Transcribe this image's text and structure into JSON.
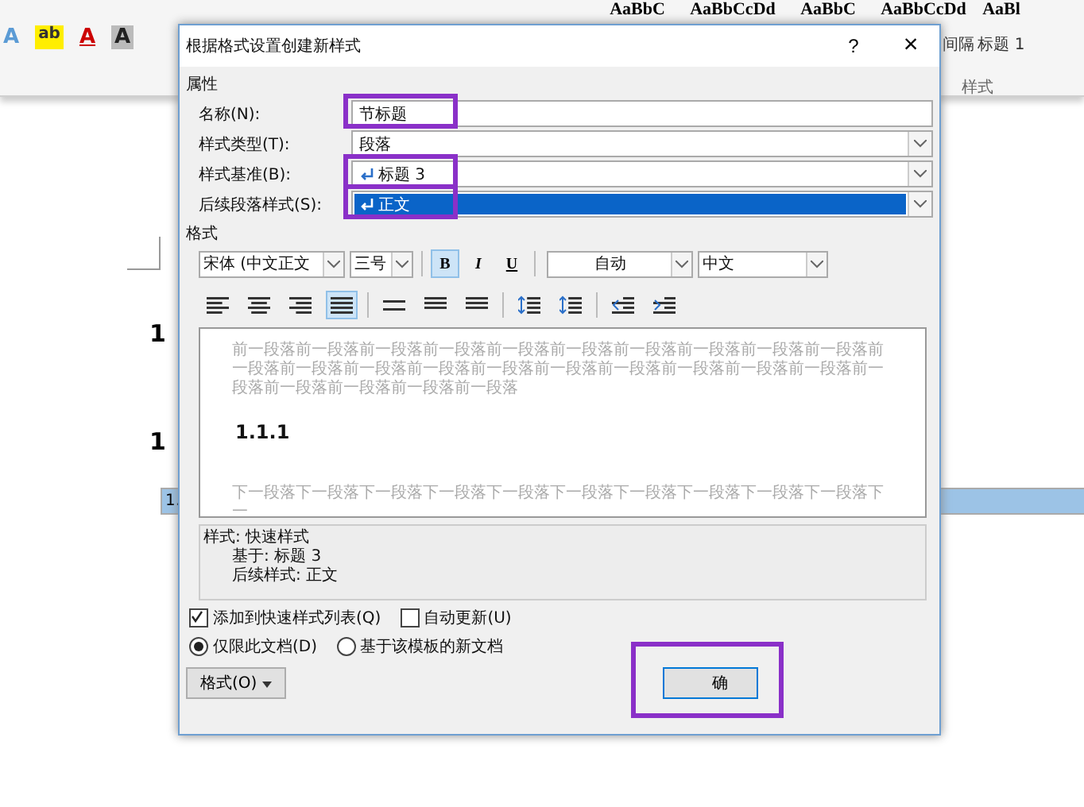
{
  "ribbon": {
    "tools": [
      "A",
      "ab",
      "A",
      "A"
    ],
    "styles": [
      {
        "preview": "AaBbC"
      },
      {
        "preview": "AaBbCcDd"
      },
      {
        "preview": "AaBbC"
      },
      {
        "preview": "AaBbCcDd",
        "label": "间隔"
      },
      {
        "preview": "AaBl",
        "label": "标题 1"
      }
    ],
    "group_label": "样式"
  },
  "document": {
    "lines": [
      {
        "text": "1",
        "selected": false
      },
      {
        "text": "1",
        "selected": false
      },
      {
        "text": "1.",
        "selected": true
      }
    ]
  },
  "dialog": {
    "title": "根据格式设置创建新样式",
    "help": "?",
    "close": "×",
    "properties_label": "属性",
    "fields": [
      {
        "label": "名称(N):",
        "value": "节标题",
        "kind": "text",
        "highlighted": true,
        "selected": false
      },
      {
        "label": "样式类型(T):",
        "value": "段落",
        "kind": "select",
        "highlighted": false,
        "selected": false
      },
      {
        "label": "样式基准(B):",
        "value": "标题 3",
        "kind": "select-style",
        "highlighted": true,
        "selected": false
      },
      {
        "label": "后续段落样式(S):",
        "value": "正文",
        "kind": "select-style",
        "highlighted": true,
        "selected": true
      }
    ],
    "format_label": "格式",
    "font": "宋体 (中文正文",
    "size": "三号",
    "styles": [
      {
        "label": "B",
        "selected": true
      },
      {
        "label": "I",
        "selected": false
      },
      {
        "label": "U",
        "selected": false
      }
    ],
    "font_color": "自动",
    "language": "中文",
    "align_buttons": [
      {
        "kind": "align-left",
        "selected": false
      },
      {
        "kind": "align-center",
        "selected": false
      },
      {
        "kind": "align-right",
        "selected": false
      },
      {
        "kind": "justify",
        "selected": true
      },
      {
        "kind": "single-space",
        "selected": false
      },
      {
        "kind": "one-half-space",
        "selected": false
      },
      {
        "kind": "double-space",
        "selected": false
      },
      {
        "kind": "space-before",
        "selected": false
      },
      {
        "kind": "space-after",
        "selected": false
      },
      {
        "kind": "indent-decrease",
        "selected": false
      },
      {
        "kind": "indent-increase",
        "selected": false
      }
    ],
    "preview": {
      "previous": "前一段落前一段落前一段落前一段落前一段落前一段落前一段落前一段落前一段落前一段落前一段落前一段落前一段落前一段落前一段落前一段落前一段落前一段落前一段落前一段落前一段落前一段落前一段落前一段落前一段落",
      "heading": "1.1.1",
      "next": "下一段落下一段落下一段落下一段落下一段落下一段落下一段落下一段落下一段落下一段落下一"
    },
    "description": [
      "样式: 快速样式",
      "基于: 标题 3",
      "后续样式: 正文"
    ],
    "checkboxes": [
      {
        "label": "添加到快速样式列表(Q)",
        "checked": true
      },
      {
        "label": "自动更新(U)",
        "checked": false
      }
    ],
    "radios": [
      {
        "label": "仅限此文档(D)",
        "selected": true
      },
      {
        "label": "基于该模板的新文档",
        "selected": false
      }
    ],
    "format_button": "格式(O)",
    "ok_button": {
      "label": "确",
      "highlighted": true
    }
  }
}
